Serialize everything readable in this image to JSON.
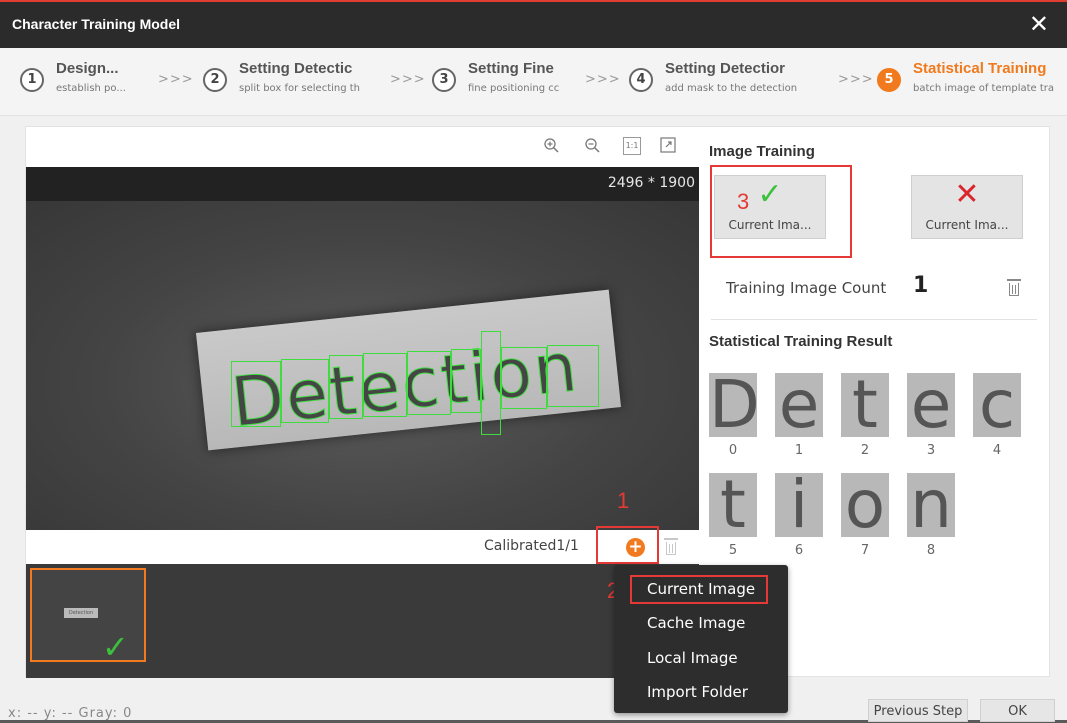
{
  "window": {
    "title": "Character Training Model",
    "close_symbol": "✕"
  },
  "steps": [
    {
      "num": "1",
      "title": "Design...",
      "desc": "establish po...",
      "active": false
    },
    {
      "num": "2",
      "title": "Setting Detectic",
      "desc": "split box for selecting th",
      "active": false
    },
    {
      "num": "3",
      "title": "Setting Fine",
      "desc": "fine positioning cc",
      "active": false
    },
    {
      "num": "4",
      "title": "Setting Detectior",
      "desc": "add mask to the detection",
      "active": false
    },
    {
      "num": "5",
      "title": "Statistical Training",
      "desc": "batch image of template tra",
      "active": true
    }
  ],
  "step_separator": ">>>",
  "viewer": {
    "resolution": "2496 * 1900",
    "image_text": "Detection",
    "calibration_status": "Calibrated1/1",
    "add_symbol": "+",
    "thumbnail_text": "Detection"
  },
  "image_training": {
    "title": "Image Training",
    "ok_button": {
      "label": "Current Ima...",
      "icon": "check-icon",
      "color": "#3cc13c"
    },
    "ng_button": {
      "label": "Current Ima...",
      "icon": "cross-icon",
      "color": "#d9252b"
    },
    "count_label": "Training Image Count",
    "count_value": "1"
  },
  "result": {
    "title": "Statistical Training Result",
    "chars": [
      {
        "ch": "D",
        "idx": "0"
      },
      {
        "ch": "e",
        "idx": "1"
      },
      {
        "ch": "t",
        "idx": "2"
      },
      {
        "ch": "e",
        "idx": "3"
      },
      {
        "ch": "c",
        "idx": "4"
      },
      {
        "ch": "t",
        "idx": "5"
      },
      {
        "ch": "i",
        "idx": "6"
      },
      {
        "ch": "o",
        "idx": "7"
      },
      {
        "ch": "n",
        "idx": "8"
      }
    ]
  },
  "add_menu": {
    "items": [
      "Current Image",
      "Cache Image",
      "Local Image",
      "Import Folder"
    ],
    "highlighted": "Current Image"
  },
  "annotations": {
    "a1": "1",
    "a2": "2",
    "a3": "3"
  },
  "status": {
    "coords": "x: --  y: --  Gray: 0"
  },
  "footer": {
    "previous_label": "Previous Step",
    "ok_label": "OK"
  },
  "colors": {
    "accent": "#f07a1d",
    "annotation": "#e53935",
    "titlebar": "#2b2b2b"
  }
}
